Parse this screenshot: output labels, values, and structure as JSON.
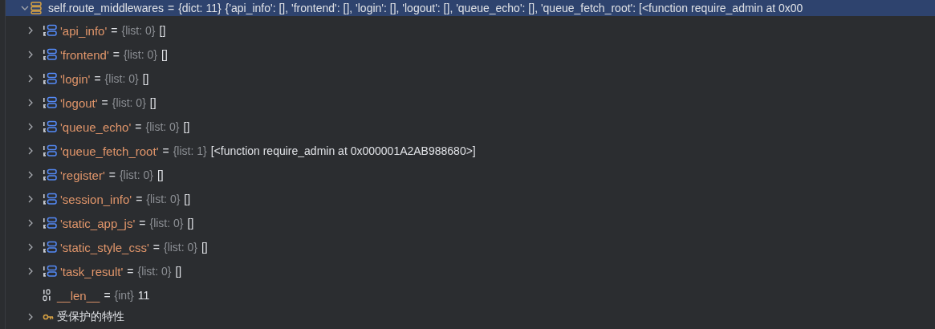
{
  "tree": {
    "kind": "dict",
    "name": "self.route_middlewares",
    "separator": "=",
    "type": "{dict: 11}",
    "value": "{'api_info': [], 'frontend': [], 'login': [], 'logout': [], 'queue_echo': [], 'queue_fetch_root': [<function require_admin at 0x00",
    "expanded": true,
    "selected": true,
    "children": [
      {
        "kind": "list",
        "name": "'api_info'",
        "separator": "=",
        "type": "{list: 0}",
        "value": "[]",
        "expanded": false,
        "selected": false
      },
      {
        "kind": "list",
        "name": "'frontend'",
        "separator": "=",
        "type": "{list: 0}",
        "value": "[]",
        "expanded": false,
        "selected": false
      },
      {
        "kind": "list",
        "name": "'login'",
        "separator": "=",
        "type": "{list: 0}",
        "value": "[]",
        "expanded": false,
        "selected": false
      },
      {
        "kind": "list",
        "name": "'logout'",
        "separator": "=",
        "type": "{list: 0}",
        "value": "[]",
        "expanded": false,
        "selected": false
      },
      {
        "kind": "list",
        "name": "'queue_echo'",
        "separator": "=",
        "type": "{list: 0}",
        "value": "[]",
        "expanded": false,
        "selected": false
      },
      {
        "kind": "list",
        "name": "'queue_fetch_root'",
        "separator": "=",
        "type": "{list: 1}",
        "value": "[<function require_admin at 0x000001A2AB988680>]",
        "expanded": false,
        "selected": false
      },
      {
        "kind": "list",
        "name": "'register'",
        "separator": "=",
        "type": "{list: 0}",
        "value": "[]",
        "expanded": false,
        "selected": false
      },
      {
        "kind": "list",
        "name": "'session_info'",
        "separator": "=",
        "type": "{list: 0}",
        "value": "[]",
        "expanded": false,
        "selected": false
      },
      {
        "kind": "list",
        "name": "'static_app_js'",
        "separator": "=",
        "type": "{list: 0}",
        "value": "[]",
        "expanded": false,
        "selected": false
      },
      {
        "kind": "list",
        "name": "'static_style_css'",
        "separator": "=",
        "type": "{list: 0}",
        "value": "[]",
        "expanded": false,
        "selected": false
      },
      {
        "kind": "list",
        "name": "'task_result'",
        "separator": "=",
        "type": "{list: 0}",
        "value": "[]",
        "expanded": false,
        "selected": false
      },
      {
        "kind": "int",
        "name": "__len__",
        "separator": "=",
        "type": "{int}",
        "value": "11",
        "selected": false
      },
      {
        "kind": "group",
        "name": "受保护的特性",
        "expanded": false,
        "selected": false
      }
    ]
  }
}
